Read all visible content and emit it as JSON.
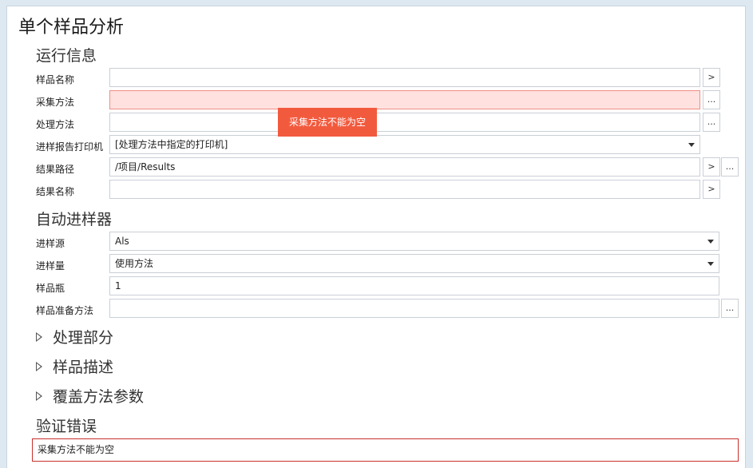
{
  "page": {
    "title": "单个样品分析"
  },
  "run_info": {
    "title": "运行信息",
    "sample_name": {
      "label": "样品名称",
      "value": "",
      "btn": ">"
    },
    "acq_method": {
      "label": "采集方法",
      "value": "",
      "btn": "..."
    },
    "proc_method": {
      "label": "处理方法",
      "value": "",
      "btn": "..."
    },
    "printer": {
      "label": "进样报告打印机",
      "value": "[处理方法中指定的打印机]"
    },
    "result_path": {
      "label": "结果路径",
      "value": "/项目/Results",
      "btn1": ">",
      "btn2": "..."
    },
    "result_name": {
      "label": "结果名称",
      "value": "",
      "btn": ">"
    }
  },
  "tooltip": {
    "text": "采集方法不能为空"
  },
  "autosampler": {
    "title": "自动进样器",
    "source": {
      "label": "进样源",
      "value": "Als"
    },
    "volume": {
      "label": "进样量",
      "value": "使用方法"
    },
    "vial": {
      "label": "样品瓶",
      "value": "1"
    },
    "prep": {
      "label": "样品准备方法",
      "value": "",
      "btn": "..."
    }
  },
  "groups": [
    {
      "label": "处理部分"
    },
    {
      "label": "样品描述"
    },
    {
      "label": "覆盖方法参数"
    }
  ],
  "validation": {
    "title": "验证错误",
    "message": "采集方法不能为空"
  },
  "colors": {
    "error_fill": "#ffe1df",
    "error_border": "#ee8f86",
    "tooltip_bg": "#f25a3e",
    "validation_border": "#c9302c"
  }
}
